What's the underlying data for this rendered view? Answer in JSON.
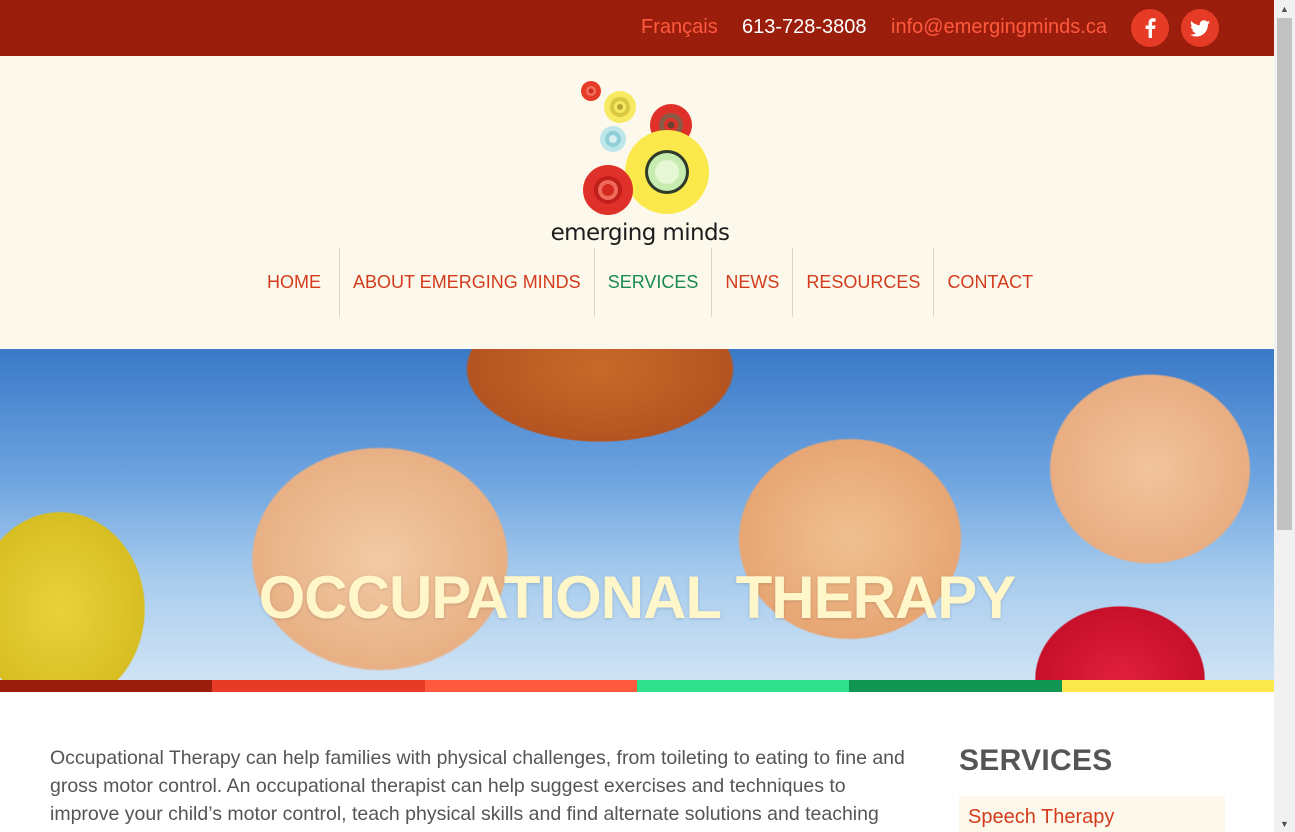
{
  "topbar": {
    "language": "Français",
    "phone": "613-728-3808",
    "email": "info@emergingminds.ca",
    "social": [
      "facebook-icon",
      "twitter-icon"
    ]
  },
  "logo": {
    "text": "emerging minds"
  },
  "nav": {
    "items": [
      {
        "label": "HOME"
      },
      {
        "label": "ABOUT EMERGING MINDS"
      },
      {
        "label": "SERVICES"
      },
      {
        "label": "NEWS"
      },
      {
        "label": "RESOURCES"
      },
      {
        "label": "CONTACT"
      }
    ],
    "active": "SERVICES"
  },
  "hero": {
    "title": "OCCUPATIONAL THERAPY"
  },
  "strip_colors": [
    "#9b1d0c",
    "#e63b26",
    "#ff5a3d",
    "#2ee08c",
    "#109552",
    "#fbe84a"
  ],
  "main": {
    "intro": "Occupational Therapy can help families with physical challenges, from toileting to eating to fine and gross motor control. An occupational therapist can help suggest exercises and techniques to improve your child’s motor control, teach physical skills and find alternate solutions and teaching"
  },
  "sidebar": {
    "title": "SERVICES",
    "items": [
      {
        "label": "Speech Therapy"
      }
    ]
  },
  "colors": {
    "brand_dark": "#9b1d0c",
    "accent": "#d33b1c",
    "active_nav": "#1a8a4e",
    "header_bg": "#fcf9ec"
  }
}
